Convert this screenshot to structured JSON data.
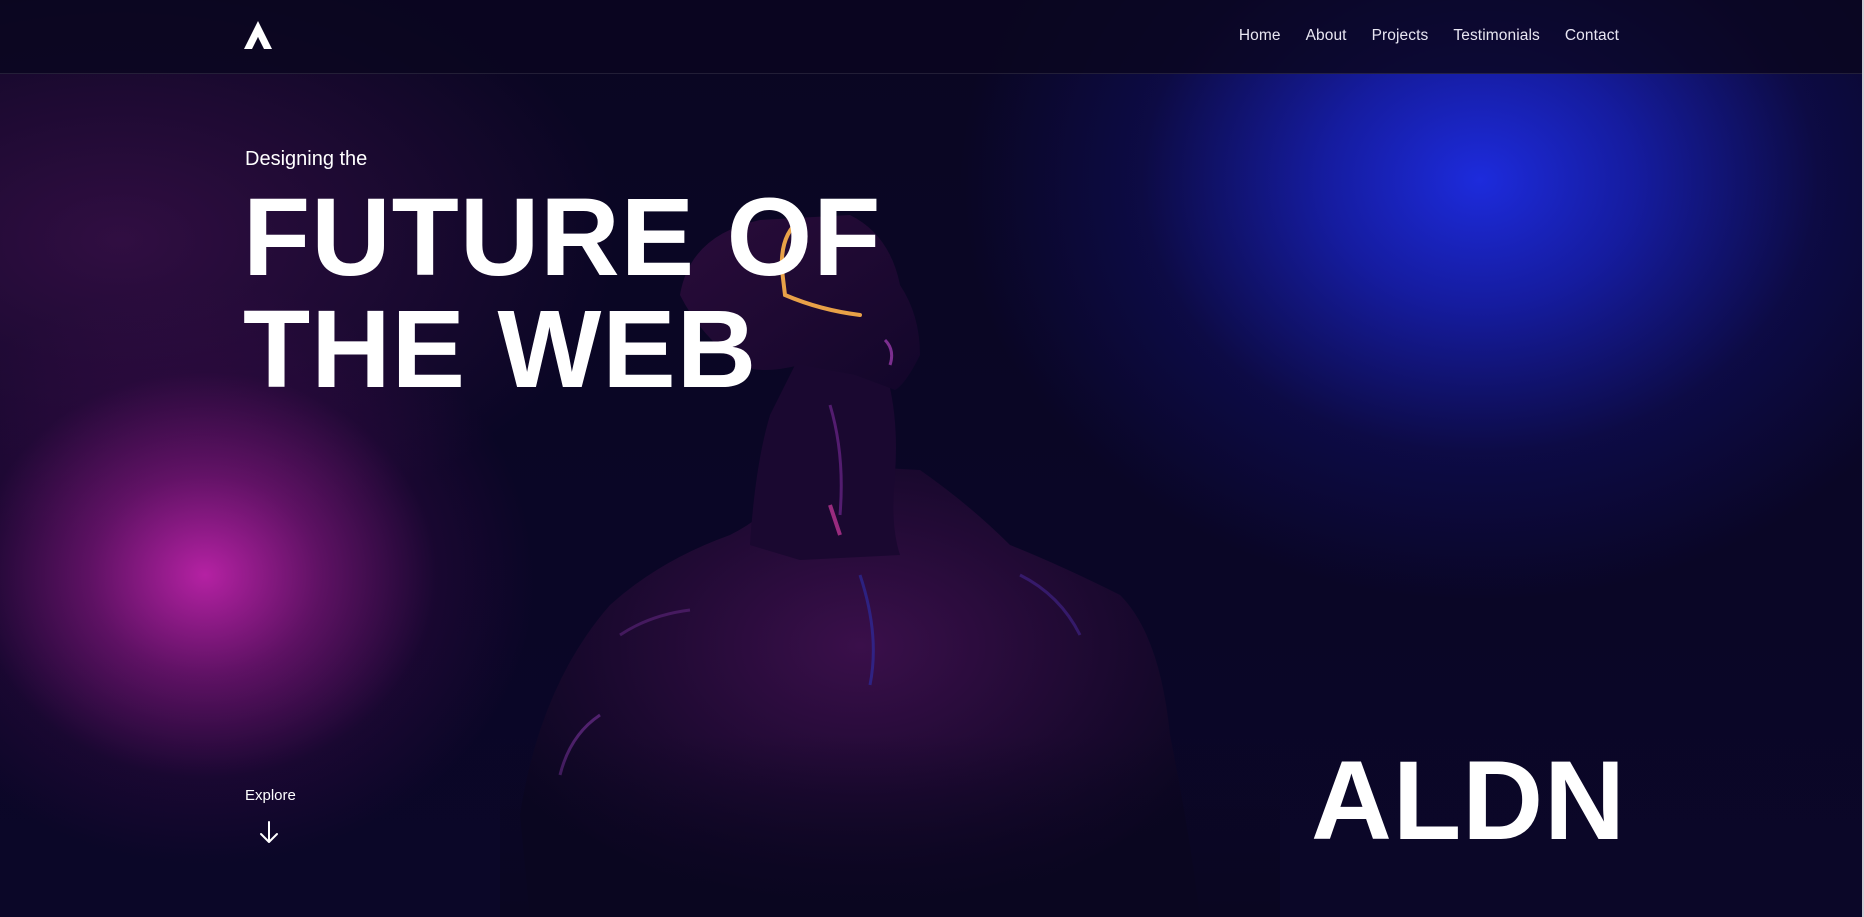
{
  "nav": {
    "items": [
      "Home",
      "About",
      "Projects",
      "Testimonials",
      "Contact"
    ]
  },
  "hero": {
    "eyebrow": "Designing the",
    "headline_line1": "FUTURE OF",
    "headline_line2": "THE WEB",
    "brand": "ALDN",
    "explore_label": "Explore"
  },
  "icons": {
    "logo": "aldn-logo-icon",
    "explore": "arrow-down-icon"
  },
  "colors": {
    "background": "#07041c",
    "magenta_glow": "#be23aa",
    "blue_glow": "#1e2de6",
    "text": "#ffffff",
    "accent_visor": "#ffb24a"
  }
}
